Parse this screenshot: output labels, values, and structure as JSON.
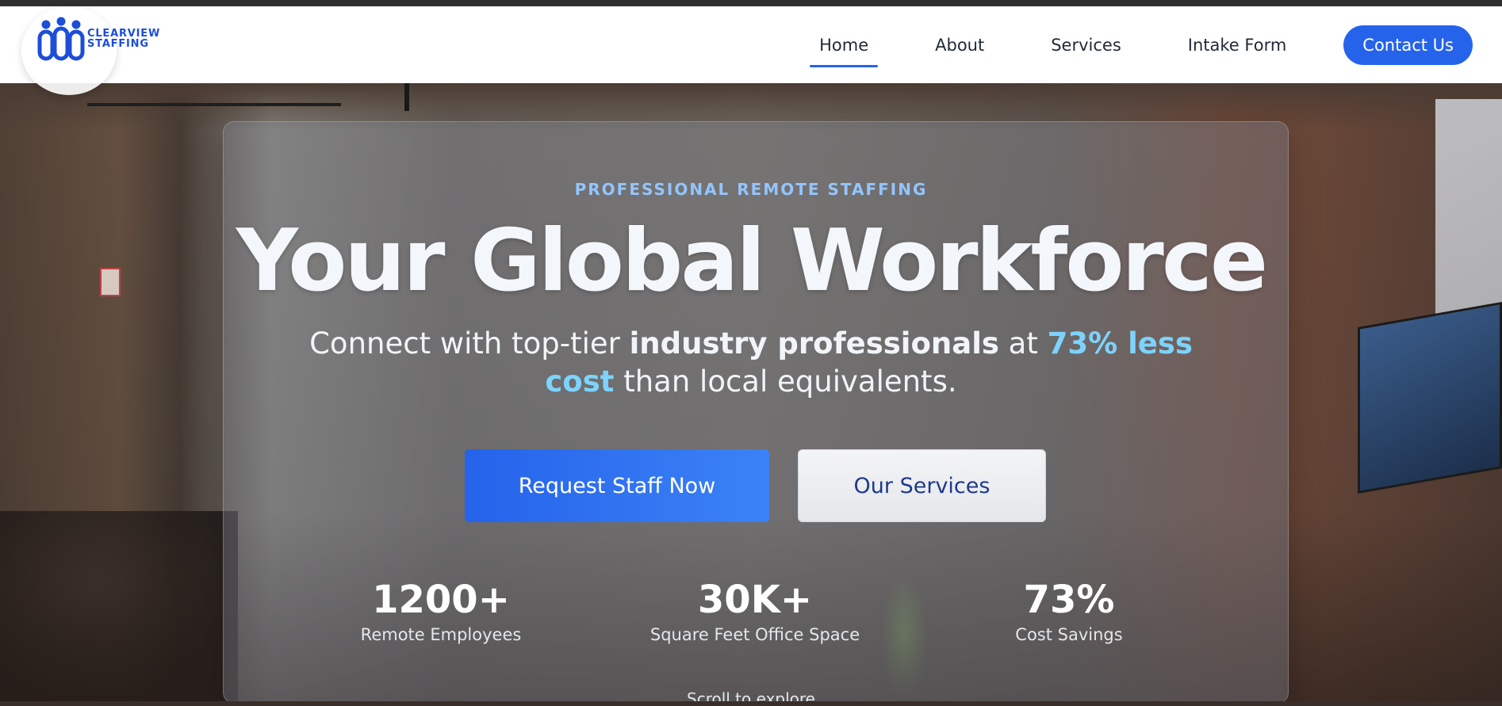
{
  "brand": {
    "logo_line1": "CLEARVIEW",
    "logo_line2": "STAFFING",
    "accent": "#2563eb"
  },
  "nav": {
    "items": [
      {
        "label": "Home",
        "active": true
      },
      {
        "label": "About"
      },
      {
        "label": "Services"
      },
      {
        "label": "Intake Form"
      }
    ],
    "cta_label": "Contact Us"
  },
  "hero": {
    "eyebrow": "PROFESSIONAL REMOTE STAFFING",
    "headline": "Your Global Workforce",
    "sub_part1": "Connect with top-tier ",
    "sub_bold": "industry professionals",
    "sub_part2": " at ",
    "sub_highlight": "73% less cost",
    "sub_part3": " than local equivalents.",
    "primary_cta": "Request Staff Now",
    "secondary_cta": "Our Services",
    "stats": [
      {
        "value": "1200+",
        "label": "Remote Employees"
      },
      {
        "value": "30K+",
        "label": "Square Feet Office Space"
      },
      {
        "value": "73%",
        "label": "Cost Savings"
      }
    ],
    "scroll_hint": "Scroll to explore"
  }
}
